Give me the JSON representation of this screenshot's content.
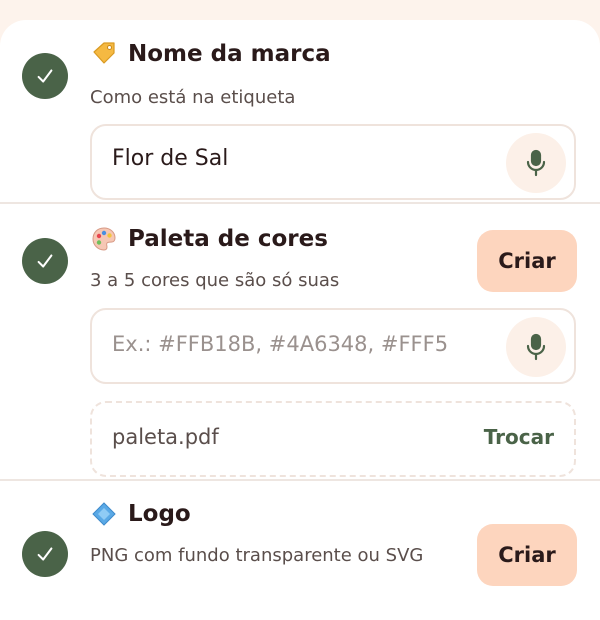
{
  "sections": [
    {
      "title": "Nome da marca",
      "icon": "tag-icon",
      "subtitle": "Como está na etiqueta",
      "input_value": "Flor de Sal",
      "status": "complete"
    },
    {
      "title": "Paleta de cores",
      "icon": "palette-icon",
      "subtitle": "3 a 5 cores que são só suas",
      "create_label": "Criar",
      "input_placeholder": "Ex.: #FFB18B, #4A6348, #FFF5",
      "file_name": "paleta.pdf",
      "file_action": "Trocar",
      "status": "complete"
    },
    {
      "title": "Logo",
      "icon": "diamond-icon",
      "subtitle": "PNG com fundo transparente ou SVG",
      "create_label": "Criar",
      "status": "complete"
    }
  ],
  "colors": {
    "check_bg": "#4A6348",
    "button_bg": "#FDD5BE",
    "page_bg": "#FDF3EC",
    "accent_text": "#4A6348"
  }
}
